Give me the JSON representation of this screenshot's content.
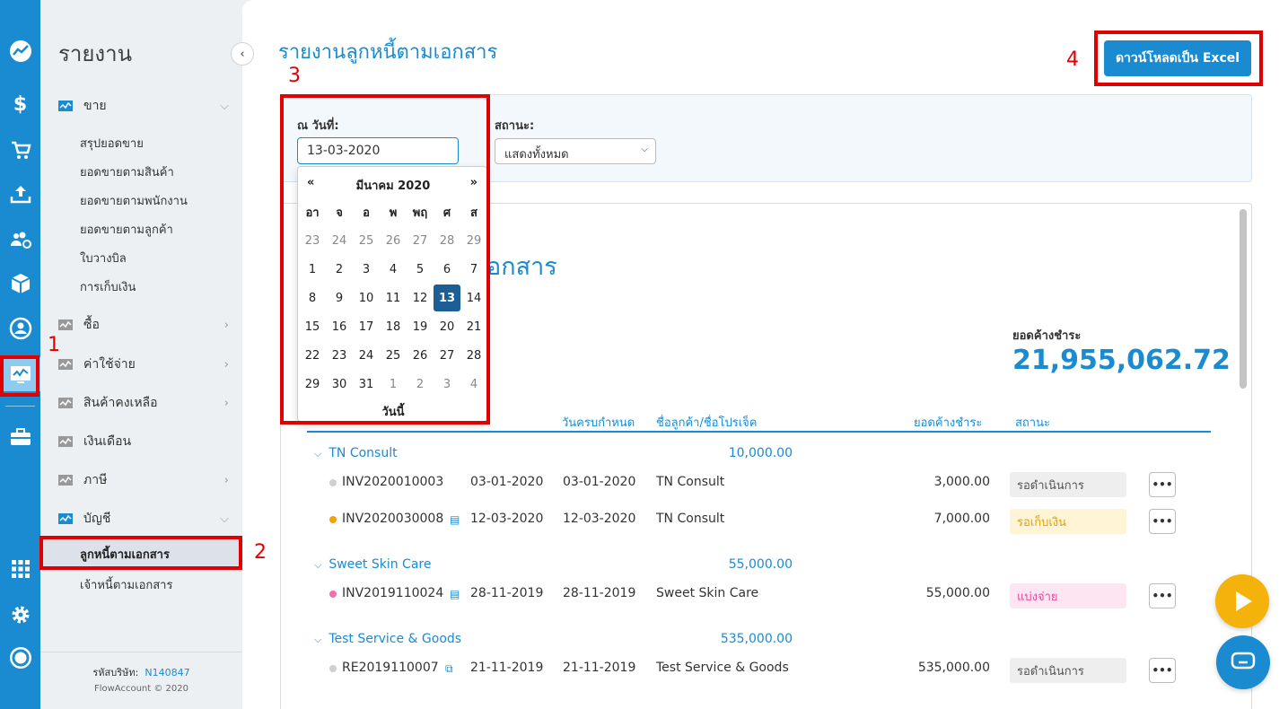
{
  "sidebar": {
    "title": "รายงาน",
    "groups": [
      {
        "label": "ขาย"
      },
      {
        "label": "ซื้อ"
      },
      {
        "label": "ค่าใช้จ่าย"
      },
      {
        "label": "สินค้าคงเหลือ"
      },
      {
        "label": "เงินเดือน"
      },
      {
        "label": "ภาษี"
      },
      {
        "label": "บัญชี"
      }
    ],
    "sales_items": [
      "สรุปยอดขาย",
      "ยอดขายตามสินค้า",
      "ยอดขายตามพนักงาน",
      "ยอดขายตามลูกค้า",
      "ใบวางบิล",
      "การเก็บเงิน"
    ],
    "account_items": [
      "ลูกหนี้ตามเอกสาร",
      "เจ้าหนี้ตามเอกสาร"
    ],
    "footer_label": "รหัสบริษัท:",
    "footer_code": "N140847",
    "footer_copyright": "FlowAccount © 2020"
  },
  "main": {
    "title": "รายงานลูกหนี้ตามเอกสาร",
    "excel_button": "ดาวน์โหลดเป็น Excel",
    "filter": {
      "date_label": "ณ วันที่:",
      "date_value": "13-03-2020",
      "status_label": "สถานะ:",
      "status_value": "แสดงทั้งหมด"
    },
    "report_heading_partial": "มเอกสาร",
    "total_label": "ยอดค้างชำระ",
    "total_value": "21,955,062.72",
    "columns": [
      "วันครบกำหนด",
      "ชื่อลูกค้า/ชื่อโปรเจ็ค",
      "ยอดค้างชำระ",
      "สถานะ"
    ],
    "groups": [
      {
        "name": "TN Consult",
        "total": "10,000.00",
        "rows": [
          {
            "doc": "INV2020010003",
            "date": "03-01-2020",
            "due": "03-01-2020",
            "customer": "TN Consult",
            "amount": "3,000.00",
            "status": "รอดำเนินการ"
          },
          {
            "doc": "INV2020030008",
            "date": "12-03-2020",
            "due": "12-03-2020",
            "customer": "TN Consult",
            "amount": "7,000.00",
            "status": "รอเก็บเงิน"
          }
        ]
      },
      {
        "name": "Sweet Skin Care",
        "total": "55,000.00",
        "rows": [
          {
            "doc": "INV2019110024",
            "date": "28-11-2019",
            "due": "28-11-2019",
            "customer": "Sweet Skin Care",
            "amount": "55,000.00",
            "status": "แบ่งจ่าย"
          }
        ]
      },
      {
        "name": "Test Service & Goods",
        "total": "535,000.00",
        "rows": [
          {
            "doc": "RE2019110007",
            "date": "21-11-2019",
            "due": "21-11-2019",
            "customer": "Test Service & Goods",
            "amount": "535,000.00",
            "status": "รอดำเนินการ"
          }
        ]
      }
    ],
    "more_label": "•••"
  },
  "datepicker": {
    "prev": "«",
    "next": "»",
    "month": "มีนาคม 2020",
    "weekdays": [
      "อา",
      "จ",
      "อ",
      "พ",
      "พฤ",
      "ศ",
      "ส"
    ],
    "weeks": [
      [
        "23",
        "24",
        "25",
        "26",
        "27",
        "28",
        "29"
      ],
      [
        "1",
        "2",
        "3",
        "4",
        "5",
        "6",
        "7"
      ],
      [
        "8",
        "9",
        "10",
        "11",
        "12",
        "13",
        "14"
      ],
      [
        "15",
        "16",
        "17",
        "18",
        "19",
        "20",
        "21"
      ],
      [
        "22",
        "23",
        "24",
        "25",
        "26",
        "27",
        "28"
      ],
      [
        "29",
        "30",
        "31",
        "1",
        "2",
        "3",
        "4"
      ]
    ],
    "selected": "13",
    "today": "วันนี้"
  },
  "annotations": [
    "1",
    "2",
    "3",
    "4"
  ],
  "colors": {
    "accent": "#1a8bd0",
    "selected_day": "#1c5f96",
    "annotation": "#e00000",
    "status_pending_bg": "#eeeeee",
    "status_collect_bg": "#fff4d6",
    "status_collect_fg": "#e6a000",
    "status_partial_bg": "#fde6f1",
    "status_partial_fg": "#e74a9a"
  }
}
